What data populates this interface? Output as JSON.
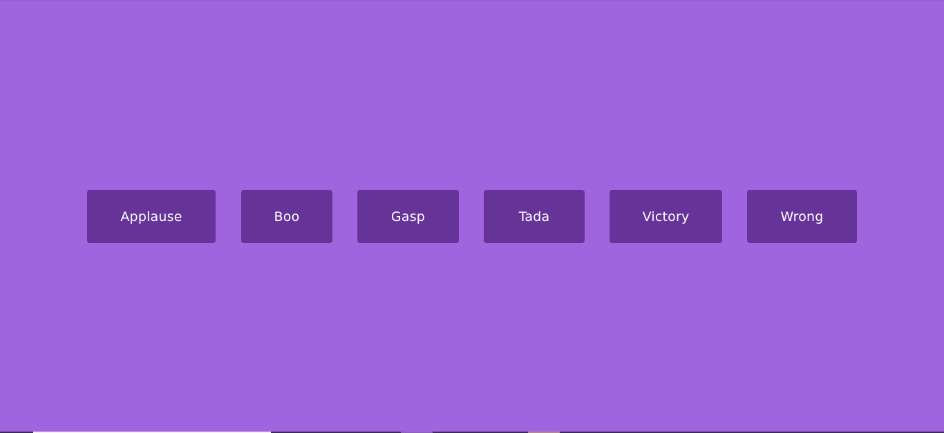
{
  "page": {
    "background_color": "#a064de",
    "button_color": "#663399",
    "button_text_color": "#ffffff"
  },
  "buttons": [
    {
      "label": "Applause"
    },
    {
      "label": "Boo"
    },
    {
      "label": "Gasp"
    },
    {
      "label": "Tada"
    },
    {
      "label": "Victory"
    },
    {
      "label": "Wrong"
    }
  ]
}
